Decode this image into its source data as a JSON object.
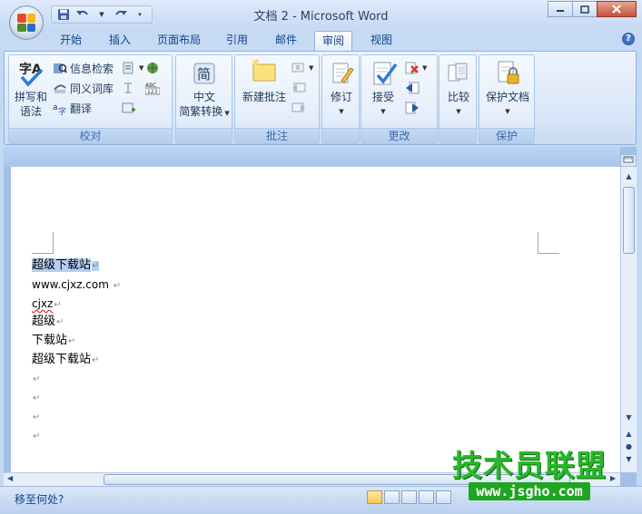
{
  "window": {
    "title": "文档 2 - Microsoft Word"
  },
  "tabs": [
    "开始",
    "插入",
    "页面布局",
    "引用",
    "邮件",
    "审阅",
    "视图"
  ],
  "active_tab": "审阅",
  "ribbon": {
    "proofing": {
      "label": "校对",
      "spelling_line1": "拼写和",
      "spelling_line2": "语法",
      "research": "信息检索",
      "thesaurus": "同义词库",
      "translate": "翻译"
    },
    "chinese": {
      "line1": "中文",
      "line2": "简繁转换"
    },
    "comments": {
      "label": "批注",
      "new_comment": "新建批注"
    },
    "tracking": {
      "revise": "修订"
    },
    "changes": {
      "label": "更改",
      "accept": "接受"
    },
    "compare": {
      "compare": "比较"
    },
    "protect": {
      "label": "保护",
      "protect_document": "保护文档"
    }
  },
  "document": {
    "lines": [
      "超级下载站",
      "www.cjxz.com ",
      "cjxz",
      "超级",
      "下载站",
      "超级下载站",
      "",
      "",
      "",
      ""
    ],
    "para_mark": "↵"
  },
  "status": {
    "text": "移至何处?"
  },
  "watermark": {
    "title": "技术员联盟",
    "url": "www.jsgho.com"
  },
  "colors": {
    "accent": "#15428b",
    "ribbon": "#dce8f8",
    "selection": "#b5cff2"
  }
}
